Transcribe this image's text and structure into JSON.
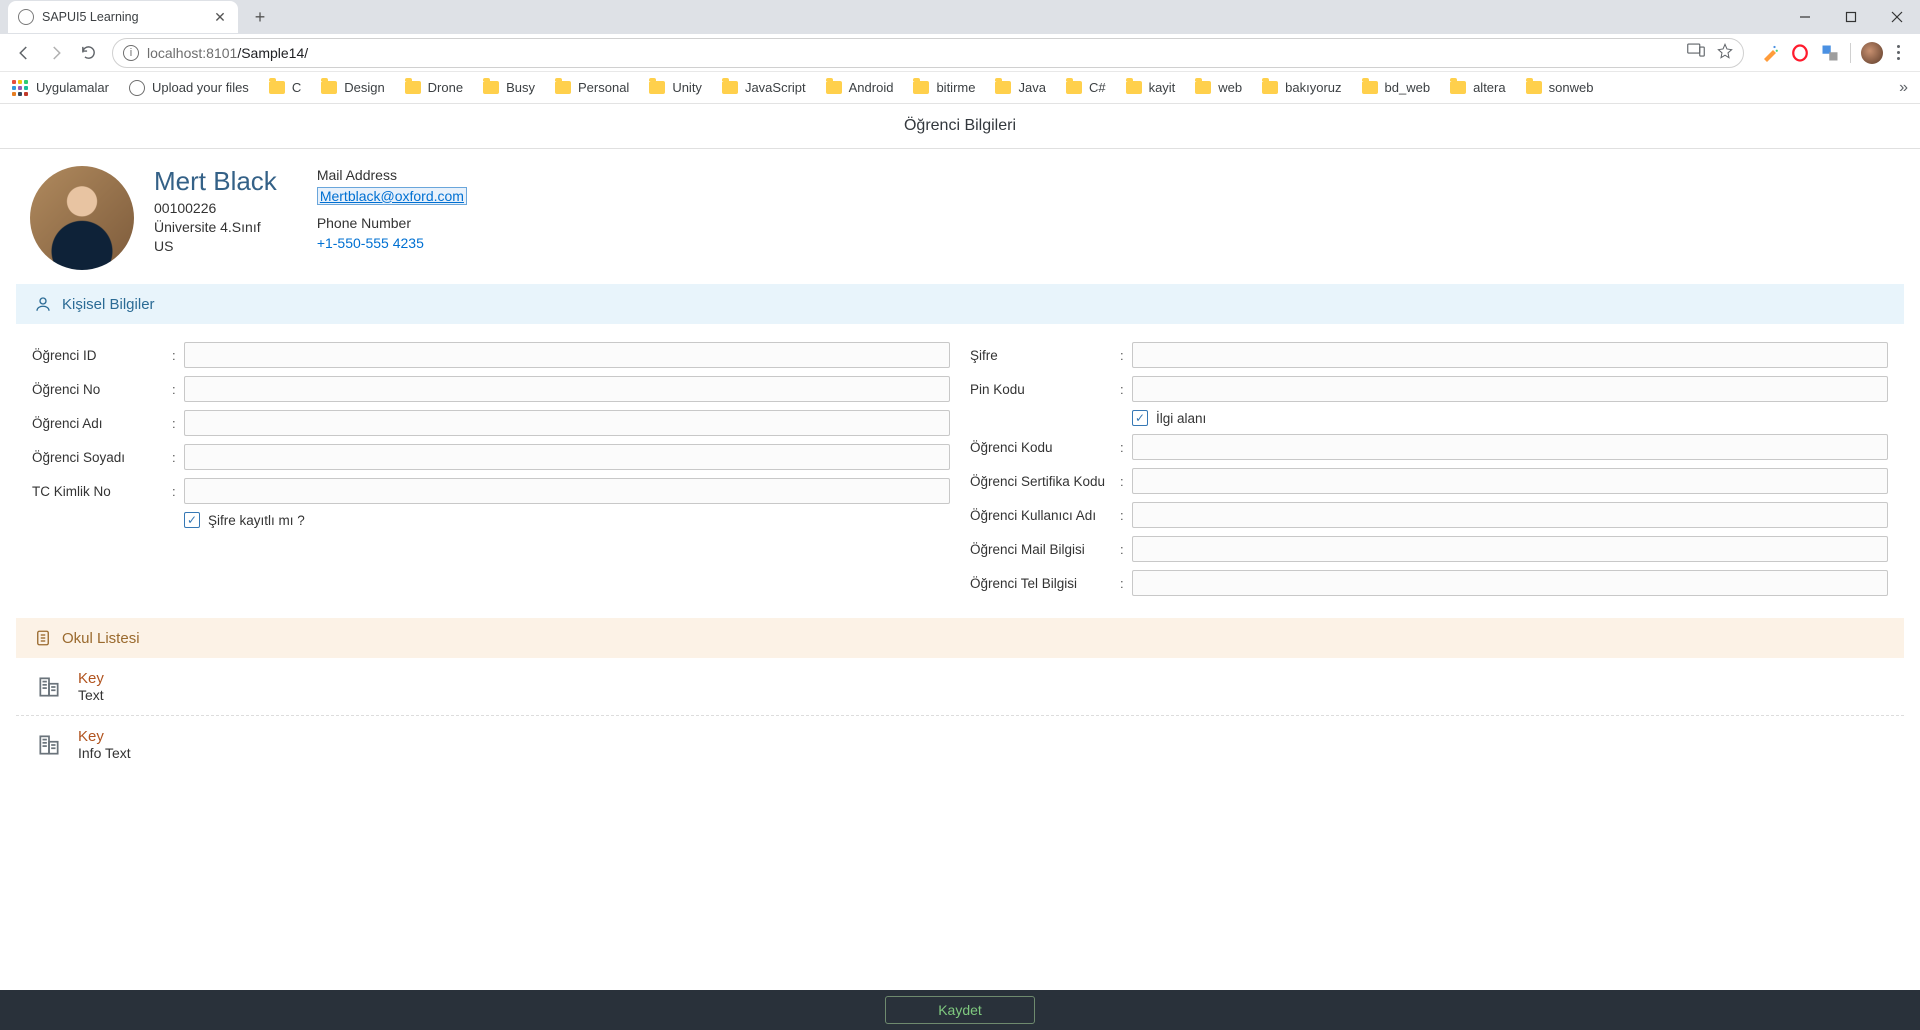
{
  "browser": {
    "tab_title": "SAPUI5 Learning",
    "url_host": "localhost",
    "url_port": ":8101",
    "url_path": "/Sample14/",
    "bookmarks": {
      "apps": "Uygulamalar",
      "upload": "Upload your files",
      "folders": [
        "C",
        "Design",
        "Drone",
        "Busy",
        "Personal",
        "Unity",
        "JavaScript",
        "Android",
        "bitirme",
        "Java",
        "C#",
        "kayit",
        "web",
        "bakıyoruz",
        "bd_web",
        "altera",
        "sonweb"
      ]
    }
  },
  "page_title": "Öğrenci Bilgileri",
  "student": {
    "name": "Mert Black",
    "id": "00100226",
    "grade": "Üniversite 4.Sınıf",
    "country": "US",
    "mail_label": "Mail Address",
    "mail": "Mertblack@oxford.com",
    "phone_label": "Phone Number",
    "phone": "+1-550-555 4235"
  },
  "sections": {
    "personal": "Kişisel Bilgiler",
    "schools": "Okul Listesi"
  },
  "labels": {
    "left": {
      "student_id": "Öğrenci ID",
      "student_no": "Öğrenci No",
      "student_name": "Öğrenci Adı",
      "student_surname": "Öğrenci Soyadı",
      "tc": "TC Kimlik No",
      "password_saved": "Şifre kayıtlı mı ?"
    },
    "right": {
      "password": "Şifre",
      "pin": "Pin Kodu",
      "interest": "İlgi alanı",
      "student_code": "Öğrenci Kodu",
      "cert_code": "Öğrenci Sertifika Kodu",
      "username": "Öğrenci Kullanıcı Adı",
      "mail": "Öğrenci Mail Bilgisi",
      "phone": "Öğrenci Tel Bilgisi"
    }
  },
  "school_list": [
    {
      "key": "Key",
      "text": "Text"
    },
    {
      "key": "Key",
      "text": "Info Text"
    }
  ],
  "footer": {
    "save": "Kaydet"
  }
}
